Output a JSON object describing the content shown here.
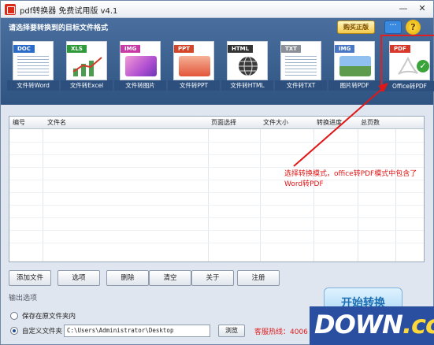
{
  "window": {
    "title": "pdf转换器 免费试用版 v4.1",
    "minimize_glyph": "—",
    "close_glyph": "✕"
  },
  "header": {
    "title": "请选择要转换到的目标文件格式",
    "vip_label": "购买正版",
    "help_glyph": "?"
  },
  "formats": [
    {
      "tag": "DOC",
      "label": "文件转Word",
      "tag_color": "#2b6cc8",
      "icon": "word-doc-icon"
    },
    {
      "tag": "XLS",
      "label": "文件转Excel",
      "tag_color": "#2f9a3a",
      "icon": "excel-chart-icon"
    },
    {
      "tag": "IMG",
      "label": "文件转图片",
      "tag_color": "#c83aa6",
      "icon": "image-icon"
    },
    {
      "tag": "PPT",
      "label": "文件转PPT",
      "tag_color": "#d4462a",
      "icon": "ppt-icon"
    },
    {
      "tag": "HTML",
      "label": "文件转HTML",
      "tag_color": "#333333",
      "icon": "globe-icon"
    },
    {
      "tag": "TXT",
      "label": "文件转TXT",
      "tag_color": "#8a8f98",
      "icon": "text-icon"
    },
    {
      "tag": "IMG",
      "label": "图片转PDF",
      "tag_color": "#4a78c4",
      "icon": "photo-icon"
    },
    {
      "tag": "PDF",
      "label": "Office转PDF",
      "tag_color": "#d9372a",
      "icon": "pdf-icon",
      "selected": true
    }
  ],
  "grid": {
    "columns": [
      "编号",
      "文件名",
      "页面选择",
      "文件大小",
      "转换进度",
      "总页数"
    ]
  },
  "annotation": {
    "text": "选择转换模式，office转PDF模式中包含了Word转PDF"
  },
  "buttons": [
    "添加文件",
    "选项",
    "删除",
    "清空",
    "关于",
    "注册"
  ],
  "output": {
    "section_label": "输出选项",
    "option_same_folder": "保存在原文件夹内",
    "option_custom_folder": "自定义文件夹",
    "path_value": "C:\\Users\\Administrator\\Desktop",
    "browse_label": "浏览",
    "hotline": "客服热线：4006"
  },
  "start_label": "开始转换",
  "watermark": {
    "main": "DOWN",
    "suffix": ".cc"
  },
  "colors": {
    "header_bg": "#2f5482",
    "accent_red": "#e02020",
    "label_bg": "#2c4f7d"
  }
}
